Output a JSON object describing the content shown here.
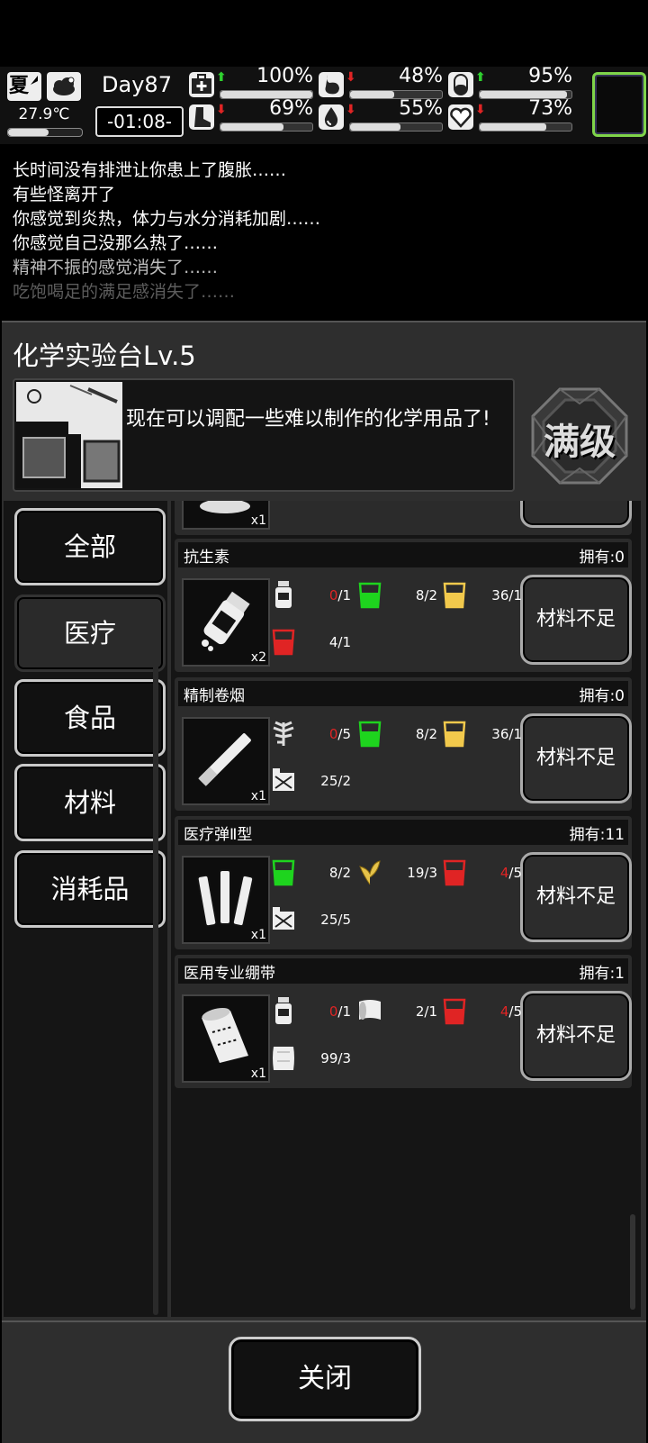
{
  "hud": {
    "season": "夏",
    "temperature": "27.9℃",
    "temperature_level": 0.55,
    "day": "Day87",
    "time": "-01:08-",
    "stats": [
      {
        "icon": "medkit-icon",
        "trend": "up",
        "value": "100%",
        "level": 1.0
      },
      {
        "icon": "stomach-icon",
        "trend": "down",
        "value": "48%",
        "level": 0.48
      },
      {
        "icon": "pill-icon",
        "trend": "up",
        "value": "95%",
        "level": 0.95
      },
      {
        "icon": "boot-icon",
        "trend": "down",
        "value": "69%",
        "level": 0.69
      },
      {
        "icon": "water-drop-icon",
        "trend": "down",
        "value": "55%",
        "level": 0.55
      },
      {
        "icon": "heart-icon",
        "trend": "down",
        "value": "73%",
        "level": 0.73
      }
    ],
    "colors": {
      "up": "#2fd12f",
      "down": "#e02424",
      "slot_border": "#7fd44a"
    }
  },
  "messages": [
    {
      "text": "长时间没有排泄让你患上了腹胀……",
      "color": "#ffffff"
    },
    {
      "text": "有些怪离开了",
      "color": "#ffffff"
    },
    {
      "text": "你感觉到炎热，体力与水分消耗加剧……",
      "color": "#ffffff"
    },
    {
      "text": "你感觉自己没那么热了……",
      "color": "#ffffff"
    },
    {
      "text": "精神不振的感觉消失了……",
      "color": "#bdbdbd"
    },
    {
      "text": "吃饱喝足的满足感消失了……",
      "color": "#5c5c5c"
    }
  ],
  "panel": {
    "title": "化学实验台Lv.5",
    "description": "现在可以调配一些难以制作的化学用品了!",
    "max_badge": "满级"
  },
  "nav": [
    "全部",
    "医疗",
    "食品",
    "材料",
    "消耗品"
  ],
  "nav_active": 1,
  "partial_item": {
    "count": "x1"
  },
  "recipes": [
    {
      "name": "抗生素",
      "owned": "拥有:0",
      "count": "x2",
      "art": "pill-bottle-icon",
      "button": "材料不足",
      "materials": [
        {
          "icon": "bottle-icon",
          "have": "0",
          "need": "/1",
          "short": true
        },
        {
          "icon": "green-liquid-icon",
          "have": "8",
          "need": "/2",
          "short": false
        },
        {
          "icon": "yellow-liquid-icon",
          "have": "36",
          "need": "/1",
          "short": false
        },
        {
          "icon": "red-liquid-icon",
          "have": "4",
          "need": "/1",
          "short": false
        }
      ]
    },
    {
      "name": "精制卷烟",
      "owned": "拥有:0",
      "count": "x1",
      "art": "cigarette-icon",
      "button": "材料不足",
      "materials": [
        {
          "icon": "tobacco-leaf-icon",
          "have": "0",
          "need": "/5",
          "short": true
        },
        {
          "icon": "green-liquid-icon",
          "have": "8",
          "need": "/2",
          "short": false
        },
        {
          "icon": "yellow-liquid-icon",
          "have": "36",
          "need": "/1",
          "short": false
        },
        {
          "icon": "fuel-can-icon",
          "have": "25",
          "need": "/2",
          "short": false
        }
      ]
    },
    {
      "name": "医疗弹Ⅱ型",
      "owned": "拥有:11",
      "count": "x1",
      "art": "med-darts-icon",
      "button": "材料不足",
      "materials": [
        {
          "icon": "green-liquid-icon",
          "have": "8",
          "need": "/2",
          "short": false
        },
        {
          "icon": "herb-icon",
          "have": "19",
          "need": "/3",
          "short": false
        },
        {
          "icon": "red-liquid-icon",
          "have": "4",
          "need": "/5",
          "short": true
        },
        {
          "icon": "fuel-can-icon",
          "have": "25",
          "need": "/5",
          "short": false
        }
      ]
    },
    {
      "name": "医用专业绷带",
      "owned": "拥有:1",
      "count": "x1",
      "art": "bandage-roll-icon",
      "button": "材料不足",
      "materials": [
        {
          "icon": "bottle-icon",
          "have": "0",
          "need": "/1",
          "short": true
        },
        {
          "icon": "cloth-roll-icon",
          "have": "2",
          "need": "/1",
          "short": false
        },
        {
          "icon": "red-liquid-icon",
          "have": "4",
          "need": "/5",
          "short": true
        },
        {
          "icon": "cloth-icon",
          "have": "99",
          "need": "/3",
          "short": false
        }
      ]
    }
  ],
  "close_label": "关闭"
}
